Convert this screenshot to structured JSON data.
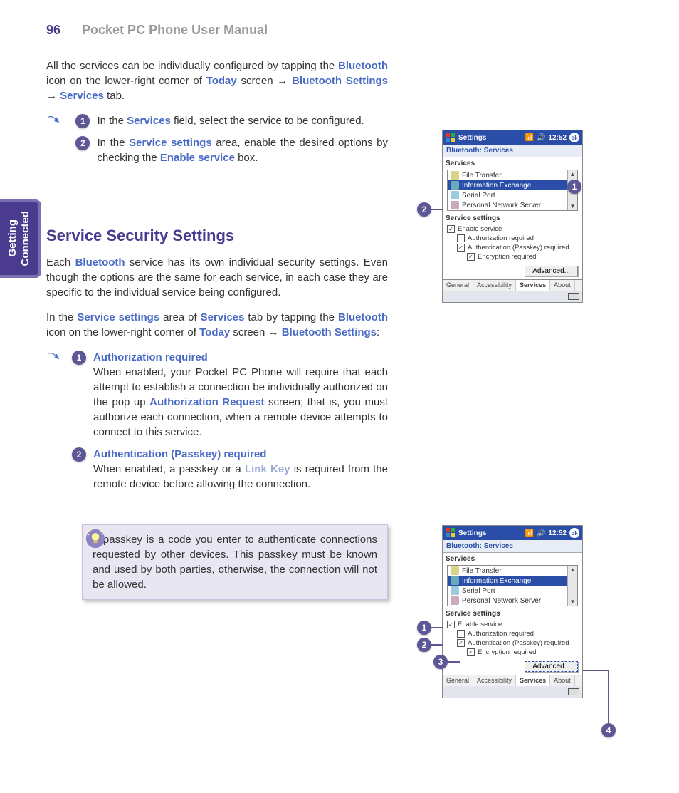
{
  "header": {
    "page_num": "96",
    "running_title": "Pocket PC Phone User Manual"
  },
  "tab": {
    "line1": "Getting",
    "line2": "Connected"
  },
  "intro": {
    "p1_a": "All the services can be individually configured by tapping the ",
    "bt": "Bluetooth",
    "p1_b": " icon on the lower-right corner of ",
    "today": "Today",
    "p1_c": " screen → ",
    "bts": "Bluetooth Settings",
    "p1_d": " → ",
    "svc": "Services",
    "p1_e": " tab."
  },
  "steps1": [
    {
      "n": "1",
      "pre": "In the ",
      "ref": "Services",
      "post": " field, select the service to be configured."
    },
    {
      "n": "2",
      "pre": "In the ",
      "ref": "Service settings",
      "mid": " area, enable the desired options by checking the ",
      "ref2": "Enable service",
      "post": " box."
    }
  ],
  "section2": {
    "title": "Service Security Settings",
    "p1_a": "Each ",
    "bt": "Bluetooth",
    "p1_b": " service has its own individual security settings. Even though the options are the same for each service, in each case they are specific to the individual service being configured.",
    "p2_a": "In the ",
    "ss": "Service settings",
    "p2_b": " area of ",
    "svc": "Services",
    "p2_c": " tab by tapping the ",
    "bt2": "Bluetooth",
    "p2_d": " icon on the lower-right corner of ",
    "today": "Today",
    "p2_e": " screen → ",
    "bts": "Bluetooth Settings",
    "p2_f": ":"
  },
  "steps2": [
    {
      "n": "1",
      "head": "Authorization required",
      "body_a": "When enabled, your Pocket PC Phone will require that each attempt to establish a connection be individually authorized on the pop up ",
      "ref": "Authorization Request",
      "body_b": " screen; that is, you must authorize each connection, when a remote device attempts to connect to this service."
    },
    {
      "n": "2",
      "head": "Authentication (Passkey) required",
      "body_a": "When enabled, a passkey or a ",
      "ref": "Link Key",
      "body_b": " is required from the remote device before allowing the connection."
    }
  ],
  "tip": "A passkey is a code you enter to authenticate connections requested by other devices. This passkey must be known and used by both parties, otherwise, the connection will not be allowed.",
  "shot": {
    "title": "Settings",
    "time": "12:52",
    "ok": "ok",
    "subtitle": "Bluetooth: Services",
    "section_services": "Services",
    "services": [
      "File Transfer",
      "Information Exchange",
      "Serial Port",
      "Personal Network Server"
    ],
    "section_settings": "Service settings",
    "checks": [
      {
        "label": "Enable service",
        "checked": true,
        "indent": 0
      },
      {
        "label": "Authorization required",
        "checked": false,
        "indent": 1
      },
      {
        "label": "Authentication (Passkey) required",
        "checked": true,
        "indent": 1
      },
      {
        "label": "Encryption required",
        "checked": true,
        "indent": 2
      }
    ],
    "advanced": "Advanced...",
    "tabs": [
      "General",
      "Accessibility",
      "Services",
      "About"
    ]
  },
  "callouts1": {
    "a": "1",
    "b": "2"
  },
  "callouts2": {
    "a": "1",
    "b": "2",
    "c": "3",
    "d": "4"
  }
}
